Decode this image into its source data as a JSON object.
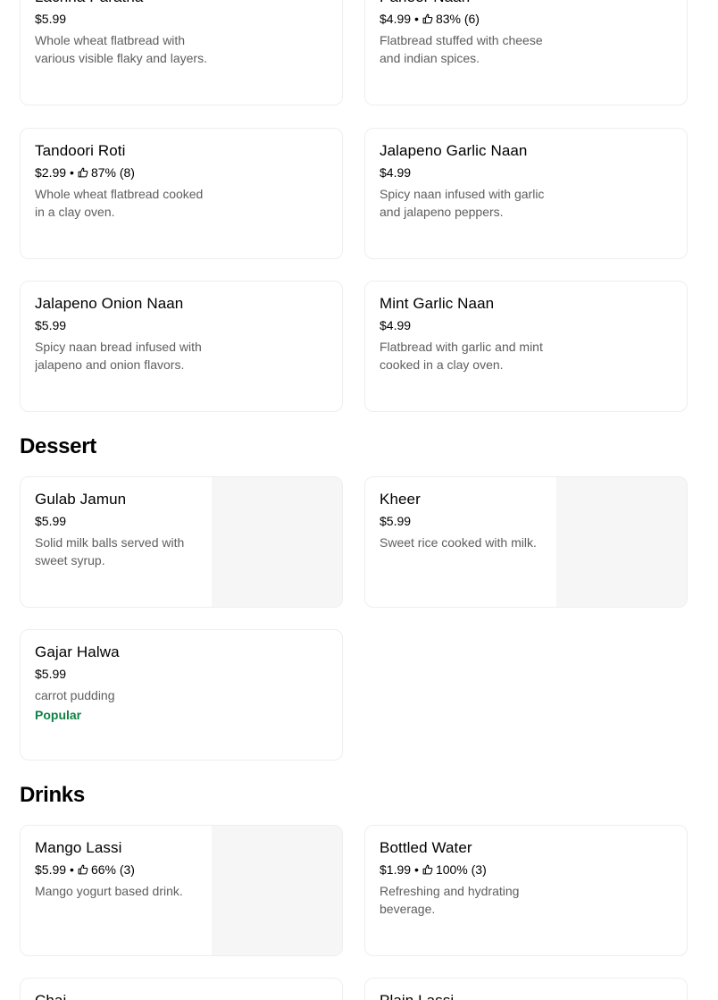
{
  "partial_top": {
    "left": {
      "title": "Lachha Paratha",
      "price": "$5.99",
      "desc": "Whole wheat flatbread with various visible flaky and layers."
    },
    "right": {
      "title": "Paneer Naan",
      "price": "$4.99",
      "rating": "83% (6)",
      "desc": "Flatbread stuffed with cheese and indian spices."
    }
  },
  "breads": [
    {
      "title": "Tandoori Roti",
      "price": "$2.99",
      "rating": "87% (8)",
      "desc": "Whole wheat flatbread cooked in a clay oven."
    },
    {
      "title": "Jalapeno Garlic Naan",
      "price": "$4.99",
      "desc": "Spicy naan infused with garlic and jalapeno peppers."
    },
    {
      "title": "Jalapeno Onion Naan",
      "price": "$5.99",
      "desc": "Spicy naan bread infused with jalapeno and onion flavors."
    },
    {
      "title": "Mint Garlic Naan",
      "price": "$4.99",
      "desc": "Flatbread with garlic and mint cooked in a clay oven."
    }
  ],
  "dessert": {
    "heading": "Dessert",
    "items": [
      {
        "title": "Gulab Jamun",
        "price": "$5.99",
        "desc": "Solid milk balls served with sweet syrup."
      },
      {
        "title": "Kheer",
        "price": "$5.99",
        "desc": "Sweet rice cooked with milk."
      },
      {
        "title": "Gajar Halwa",
        "price": "$5.99",
        "desc": "carrot pudding",
        "badge": "Popular"
      }
    ]
  },
  "drinks": {
    "heading": "Drinks",
    "items": [
      {
        "title": "Mango Lassi",
        "price": "$5.99",
        "rating": "66% (3)",
        "desc": "Mango yogurt based drink."
      },
      {
        "title": "Bottled Water",
        "price": "$1.99",
        "rating": "100% (3)",
        "desc": "Refreshing and hydrating beverage."
      },
      {
        "title": "Chai"
      },
      {
        "title": "Plain Lassi"
      }
    ]
  },
  "meta_separator": "•",
  "icons": {
    "rating": "thumbs-up-icon"
  },
  "colors": {
    "popular_badge": "#0e8345",
    "description": "#5e5e5e",
    "image_placeholder": "#f6f6f6"
  }
}
